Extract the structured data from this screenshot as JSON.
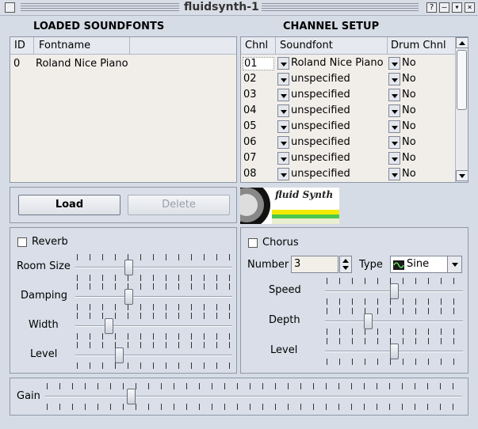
{
  "window": {
    "title": "fluidsynth-1"
  },
  "soundfonts": {
    "title": "LOADED SOUNDFONTS",
    "columns": [
      "ID",
      "Fontname"
    ],
    "rows": [
      {
        "id": "0",
        "name": "Roland Nice Piano"
      }
    ],
    "load_label": "Load",
    "delete_label": "Delete"
  },
  "channels": {
    "title": "CHANNEL SETUP",
    "columns": [
      "Chnl",
      "Soundfont",
      "Drum Chnl"
    ],
    "rows": [
      {
        "chnl": "01",
        "soundfont": "Roland Nice Piano",
        "drum": "No"
      },
      {
        "chnl": "02",
        "soundfont": "unspecified",
        "drum": "No"
      },
      {
        "chnl": "03",
        "soundfont": "unspecified",
        "drum": "No"
      },
      {
        "chnl": "04",
        "soundfont": "unspecified",
        "drum": "No"
      },
      {
        "chnl": "05",
        "soundfont": "unspecified",
        "drum": "No"
      },
      {
        "chnl": "06",
        "soundfont": "unspecified",
        "drum": "No"
      },
      {
        "chnl": "07",
        "soundfont": "unspecified",
        "drum": "No"
      },
      {
        "chnl": "08",
        "soundfont": "unspecified",
        "drum": "No"
      }
    ]
  },
  "logo": {
    "text": "fluid Synth"
  },
  "reverb": {
    "label": "Reverb",
    "enabled": false,
    "room_size_label": "Room Size",
    "room_size": 0.33,
    "damping_label": "Damping",
    "damping": 0.33,
    "width_label": "Width",
    "width": 0.2,
    "level_label": "Level",
    "level": 0.27
  },
  "chorus": {
    "label": "Chorus",
    "enabled": false,
    "number_label": "Number",
    "number": "3",
    "type_label": "Type",
    "type": "Sine",
    "speed_label": "Speed",
    "speed": 0.5,
    "depth_label": "Depth",
    "depth": 0.3,
    "level_label": "Level",
    "level": 0.5
  },
  "gain": {
    "label": "Gain",
    "value": 0.2
  },
  "colors": {
    "logo_yellow": "#f3e900",
    "logo_green": "#4cc84c"
  }
}
